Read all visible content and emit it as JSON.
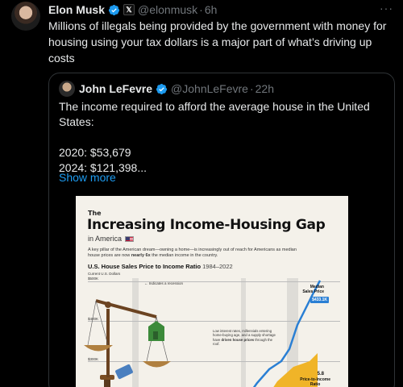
{
  "tweet": {
    "author_name": "Elon Musk",
    "handle": "@elonmusk",
    "separator": "·",
    "time": "6h",
    "more": "···",
    "text": "Millions of illegals being provided by the government with money for housing using your tax dollars is a major part of what’s driving up costs"
  },
  "quote": {
    "author_name": "John LeFevre",
    "handle": "@JohnLeFevre",
    "separator": "·",
    "time": "22h",
    "line1": "The income required to afford the average house in the United States:",
    "line2": "2020: $53,679",
    "line3": "2024: $121,398...",
    "show_more": "Show more"
  },
  "infographic": {
    "small_title": "The",
    "title": "Increasing Income-Housing Gap",
    "subtitle": "in America",
    "desc_pre": "A key pillar of the American dream—owning a home—is increasingly out of reach for Americans as median house prices are now ",
    "desc_bold": "nearly 6x",
    "desc_post": " the median income in the country.",
    "chart_title": "U.S. House Sales Price to Income Ratio",
    "chart_years": "1984–2022",
    "unit_label": "Current U.S. Dollars",
    "y_ticks": [
      "$500K",
      "$400K",
      "$300K"
    ],
    "legend": "Indicates a recession",
    "median_label_1": "Median",
    "median_label_2": "Sales Price",
    "median_value": "$433.1K",
    "note_pre": "Low interest rates, millennials entering home-buying age, and a supply shortage have ",
    "note_bold": "driven house prices",
    "note_post": " through the roof.",
    "ratio_value": "5.8",
    "ratio_label_1": "Price-to-Income",
    "ratio_label_2": "Ratio"
  },
  "colors": {
    "link": "#1d9bf0",
    "verified": "#1d9bf0",
    "price_line": "#2a7fd4",
    "income_area": "#f0b428"
  }
}
